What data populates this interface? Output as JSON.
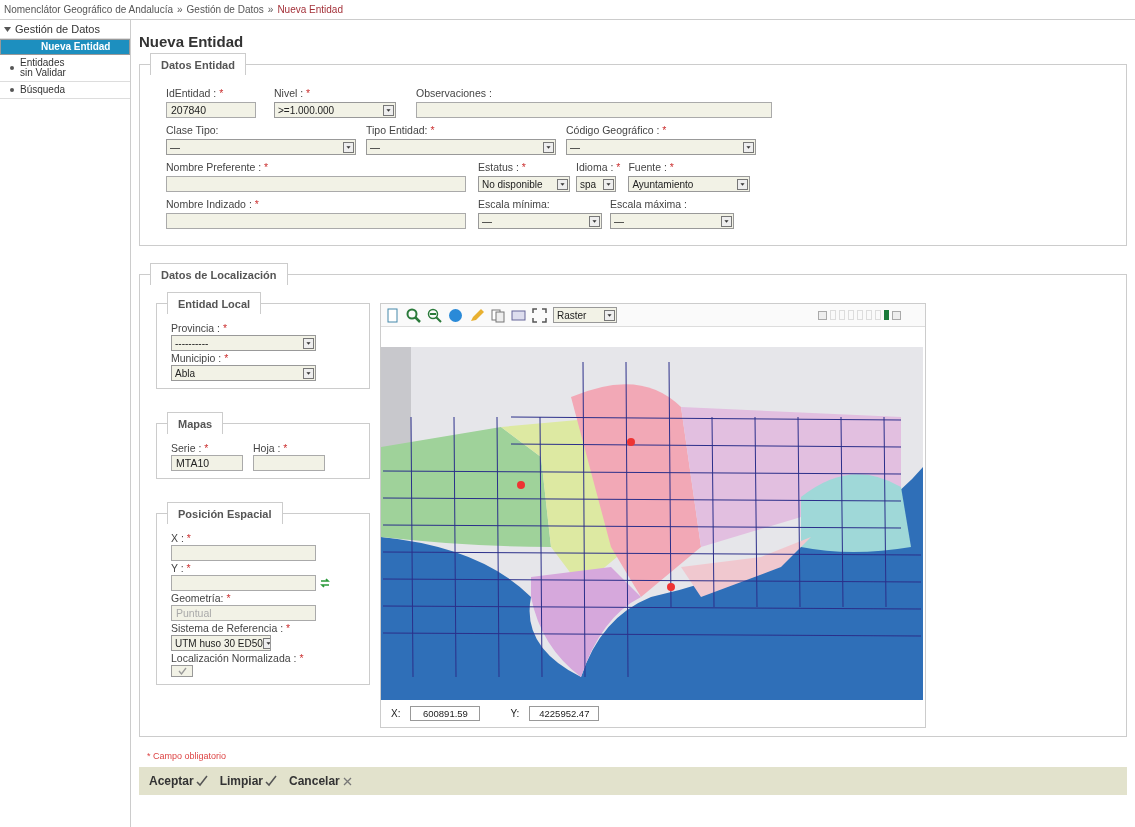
{
  "breadcrumb": [
    {
      "text": "Nomenclátor Geográfico de Andalucía",
      "current": false
    },
    {
      "text": "Gestión de Datos",
      "current": false
    },
    {
      "text": "Nueva Entidad",
      "current": true
    }
  ],
  "breadcrumb_separator": "»",
  "sidebar": {
    "header": {
      "label": "Gestión de Datos",
      "expanded": true
    },
    "items": [
      {
        "label": "Nueva Entidad",
        "selected": true
      },
      {
        "label": "Entidades sin Validar",
        "selected": false
      },
      {
        "label": "Búsqueda",
        "selected": false
      }
    ]
  },
  "page_title": "Nueva Entidad",
  "datos_entidad": {
    "legend": "Datos Entidad",
    "rows": [
      [
        {
          "label": "IdEntidad :",
          "mark": "*",
          "kind": "text",
          "value": "207840"
        },
        {
          "label": "Nivel :",
          "mark": "*",
          "kind": "select",
          "value": ">=1.000.000"
        },
        {
          "label": "Observaciones :",
          "kind": "text"
        }
      ],
      [
        {
          "label": "Clase Tipo:",
          "kind": "select",
          "value": "—"
        },
        {
          "label": "Tipo Entidad:",
          "mark": "*",
          "kind": "select",
          "value": "—"
        },
        {
          "label": "Código Geográfico :",
          "mark": "*",
          "kind": "select",
          "value": "—"
        }
      ],
      [
        {
          "label": "Nombre Preferente :",
          "mark": "*",
          "kind": "text"
        },
        {
          "label": "Estatus :",
          "mark": "*",
          "kind": "select",
          "value": "No disponible"
        },
        {
          "label": "Idioma :",
          "mark": "*",
          "kind": "select",
          "value": "spa"
        },
        {
          "label": "Fuente :",
          "mark": "*",
          "kind": "select",
          "value": "Ayuntamiento"
        }
      ],
      [
        {
          "label": "Nombre Indizado :",
          "mark": "*",
          "kind": "text"
        },
        {
          "label": "Escala mínima:",
          "kind": "select",
          "value": "—"
        },
        {
          "label": "Escala máxima :",
          "kind": "select",
          "value": "—"
        }
      ]
    ]
  },
  "localizacion": {
    "legend": "Datos de Localización",
    "entidad_local": {
      "legend": "Entidad Local",
      "fields": [
        {
          "label": "Provincia :",
          "mark": "*",
          "kind": "select",
          "value": "----------"
        },
        {
          "label": "Municipio :",
          "mark": "*",
          "kind": "select",
          "value": "Abla"
        }
      ]
    },
    "mapas": {
      "legend": "Mapas",
      "fields": [
        {
          "label": "Serie :",
          "mark": "*",
          "kind": "text",
          "value": "MTA10"
        },
        {
          "label": "Hoja :",
          "mark": "*",
          "kind": "text"
        }
      ]
    },
    "posicion": {
      "legend": "Posición Espacial",
      "fields": [
        {
          "label": "X :",
          "mark": "*",
          "kind": "text"
        },
        {
          "label": "Y :",
          "mark": "*",
          "kind": "text",
          "swap": true
        },
        {
          "label": "Geometría:",
          "mark": "*",
          "kind": "text",
          "value": "Puntual",
          "disabled": true
        },
        {
          "label": "Sistema de Referencia :",
          "mark": "*",
          "kind": "select",
          "value": "UTM huso 30 ED50"
        },
        {
          "label": "Localización Normalizada :",
          "mark": "*",
          "kind": "checkbox",
          "checked": true,
          "disabled": true
        }
      ]
    },
    "map": {
      "layer": "Raster",
      "coords": [
        {
          "label": "X:",
          "value": "600891.59"
        },
        {
          "label": "Y:",
          "value": "4225952.47"
        }
      ]
    }
  },
  "required_note": "* Campo obligatorio",
  "buttons": [
    {
      "label": "Aceptar",
      "kind": "confirm"
    },
    {
      "label": "Limpiar",
      "kind": "confirm"
    },
    {
      "label": "Cancelar",
      "kind": "cancel"
    }
  ]
}
